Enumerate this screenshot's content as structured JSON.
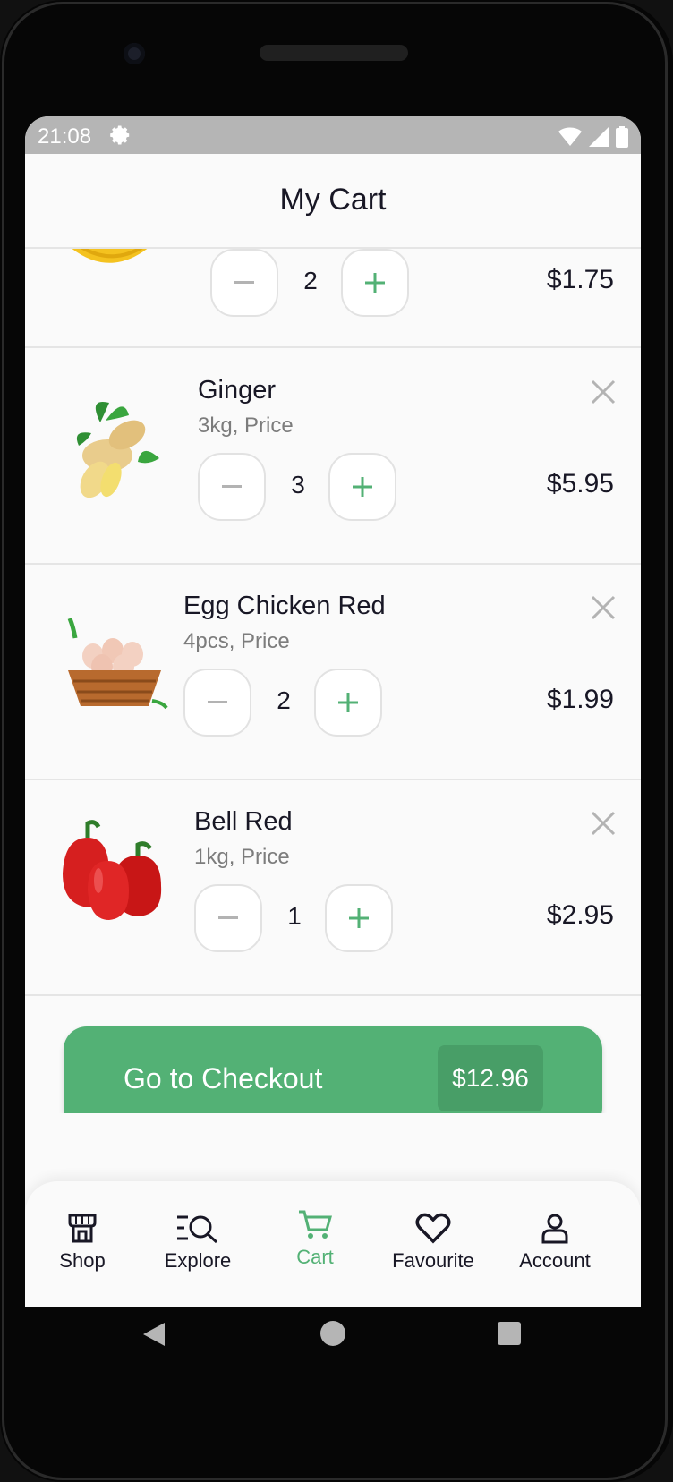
{
  "status": {
    "time": "21:08"
  },
  "header": {
    "title": "My Cart"
  },
  "cart": {
    "partial_item": {
      "quantity": "2",
      "price": "$1.75"
    },
    "items": [
      {
        "name": "Ginger",
        "detail": "3kg, Price",
        "quantity": "3",
        "price": "$5.95",
        "image": "ginger-image"
      },
      {
        "name": "Egg Chicken Red",
        "detail": "4pcs, Price",
        "quantity": "2",
        "price": "$1.99",
        "image": "eggs-basket-image"
      },
      {
        "name": "Bell Red",
        "detail": "1kg, Price",
        "quantity": "1",
        "price": "$2.95",
        "image": "red-bell-pepper-image"
      }
    ]
  },
  "checkout": {
    "label": "Go to Checkout",
    "total": "$12.96"
  },
  "tabs": [
    {
      "label": "Shop",
      "icon": "store-icon"
    },
    {
      "label": "Explore",
      "icon": "explore-icon"
    },
    {
      "label": "Cart",
      "icon": "cart-icon",
      "active": true
    },
    {
      "label": "Favourite",
      "icon": "heart-icon"
    },
    {
      "label": "Account",
      "icon": "account-icon"
    }
  ],
  "colors": {
    "accent": "#53B175",
    "text": "#181725",
    "muted": "#7C7C7C"
  }
}
